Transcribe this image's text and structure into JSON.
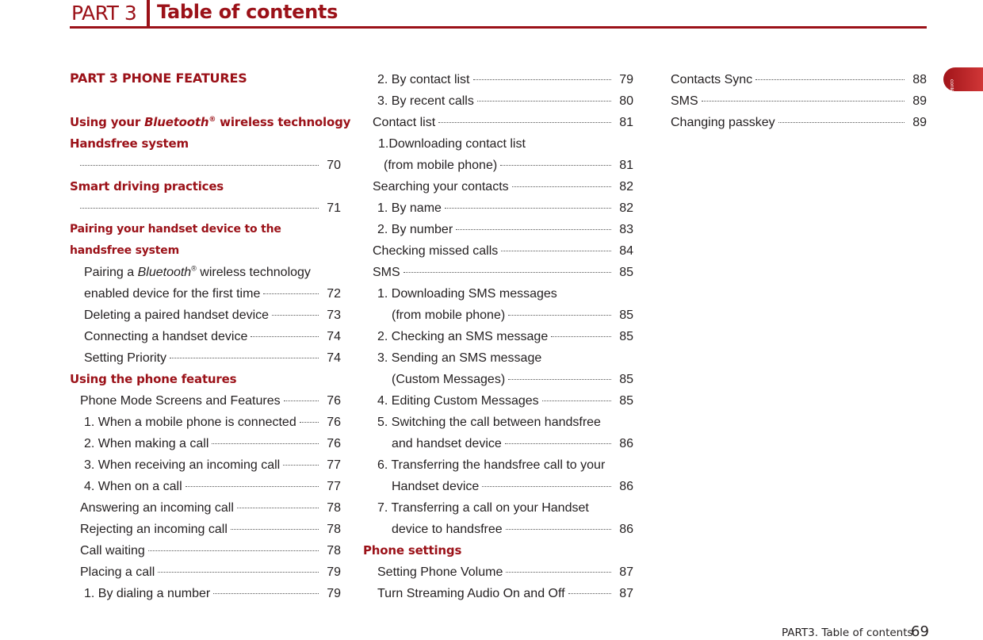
{
  "header": {
    "part": "PART 3",
    "title": "Table of contents"
  },
  "side_tab": {
    "label": "contents"
  },
  "colors": {
    "accent": "#9b1118",
    "text": "#231f20"
  },
  "toc": {
    "part_title": "PART 3   PHONE FEATURES",
    "col1": {
      "h_bluetooth_1": "Using your ",
      "h_bluetooth_ital": "Bluetooth",
      "h_bluetooth_sup": "®",
      "h_bluetooth_2": " wireless technology",
      "h_bluetooth_line2": "Handsfree system",
      "p_bluetooth": "70",
      "h_smart": "Smart driving practices",
      "p_smart": "71",
      "h_pairing_1": "Pairing your handset device to the",
      "h_pairing_2": "handsfree system",
      "pairing_first_1": "Pairing a ",
      "pairing_first_ital": "Bluetooth",
      "pairing_first_sup": "®",
      "pairing_first_2": " wireless technology",
      "pairing_first_line2": "enabled device for the first time",
      "pairing_first_page": "72",
      "entries_pairing": [
        {
          "label": "Deleting a paired handset device",
          "page": "73"
        },
        {
          "label": "Connecting a handset device",
          "page": "74"
        },
        {
          "label": "Setting Priority",
          "page": "74"
        }
      ],
      "h_using": "Using the phone features",
      "entries_using": [
        {
          "label": "Phone Mode Screens and Features",
          "page": "76"
        },
        {
          "label": "1. When a mobile phone is connected",
          "page": "76"
        },
        {
          "label": "2. When making a call",
          "page": "76"
        },
        {
          "label": "3. When receiving an incoming call",
          "page": "77"
        },
        {
          "label": "4. When on a call",
          "page": "77"
        },
        {
          "label": "Answering an incoming call",
          "page": "78"
        },
        {
          "label": "Rejecting an incoming call",
          "page": "78"
        },
        {
          "label": "Call waiting",
          "page": "78"
        },
        {
          "label": "Placing a call",
          "page": "79"
        },
        {
          "label": "1. By dialing a number",
          "page": "79"
        }
      ]
    },
    "col2": {
      "entries": [
        {
          "label": "2. By contact list",
          "page": "79"
        },
        {
          "label": "3. By recent calls",
          "page": "80"
        },
        {
          "label": "Contact list",
          "page": "81"
        },
        {
          "label": "1.Downloading contact list",
          "page": ""
        },
        {
          "label": "(from mobile phone)",
          "page": "81"
        },
        {
          "label": "Searching your contacts",
          "page": "82"
        },
        {
          "label": "1. By name",
          "page": "82"
        },
        {
          "label": "2. By number",
          "page": "83"
        },
        {
          "label": "Checking missed calls",
          "page": "84"
        },
        {
          "label": "SMS",
          "page": "85"
        },
        {
          "label": "1. Downloading SMS messages",
          "page": ""
        },
        {
          "label": "(from mobile phone)",
          "page": "85"
        },
        {
          "label": "2. Checking an SMS message",
          "page": "85"
        },
        {
          "label": "3. Sending an SMS message",
          "page": ""
        },
        {
          "label": "(Custom Messages)",
          "page": "85"
        },
        {
          "label": "4. Editing Custom Messages",
          "page": "85"
        },
        {
          "label": "5. Switching the call between handsfree",
          "page": ""
        },
        {
          "label": "and handset device",
          "page": "86"
        },
        {
          "label": "6. Transferring the handsfree call to your",
          "page": ""
        },
        {
          "label": "Handset device",
          "page": "86"
        },
        {
          "label": "7. Transferring a call on your Handset",
          "page": ""
        },
        {
          "label": "device to handsfree",
          "page": "86"
        }
      ],
      "h_settings": "Phone settings",
      "entries_settings": [
        {
          "label": "Setting Phone Volume",
          "page": "87"
        },
        {
          "label": "Turn Streaming Audio On and Off",
          "page": "87"
        }
      ]
    },
    "col3": {
      "entries": [
        {
          "label": "Contacts Sync",
          "page": "88"
        },
        {
          "label": "SMS",
          "page": "89"
        },
        {
          "label": "Changing passkey",
          "page": "89"
        }
      ]
    }
  },
  "footer": {
    "section": "PART3. Table of contents",
    "page_number": "69"
  }
}
